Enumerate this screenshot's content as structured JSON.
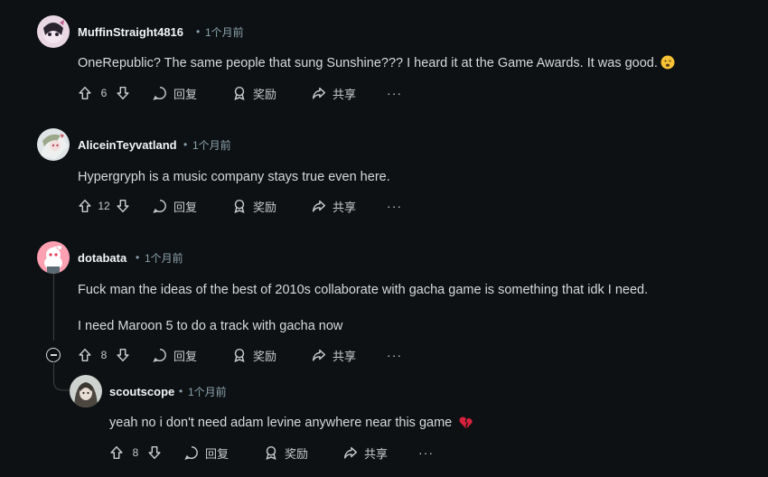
{
  "comments": [
    {
      "username": "MuffinStraight4816",
      "dot": "•",
      "time": "1个月前",
      "text": "OneRepublic? The same people that sung Sunshine??? I heard it at the Game Awards. It was good.",
      "votes": "6",
      "reply": "回复",
      "award": "奖励",
      "share": "共享",
      "more": "···"
    },
    {
      "username": "AliceinTeyvatland",
      "dot": "•",
      "time": "1个月前",
      "text": "Hypergryph is a music company stays true even here.",
      "votes": "12",
      "reply": "回复",
      "award": "奖励",
      "share": "共享",
      "more": "···"
    },
    {
      "username": "dotabata",
      "dot": "•",
      "time": "1个月前",
      "text": "Fuck man the ideas of the best of 2010s collaborate with gacha game is something that idk I need.",
      "text2": "I need Maroon 5 to do a track with gacha now",
      "votes": "8",
      "reply": "回复",
      "award": "奖励",
      "share": "共享",
      "more": "···"
    },
    {
      "username": "scoutscope",
      "dot": "•",
      "time": "1个月前",
      "text": "yeah no i don't need adam levine anywhere near this game",
      "votes": "8",
      "reply": "回复",
      "award": "奖励",
      "share": "共享",
      "more": "···"
    }
  ],
  "colors": {
    "background": "#0e1113",
    "text": "#d7dadc",
    "muted": "#8ba2ad",
    "thread_line": "#3a4146"
  }
}
